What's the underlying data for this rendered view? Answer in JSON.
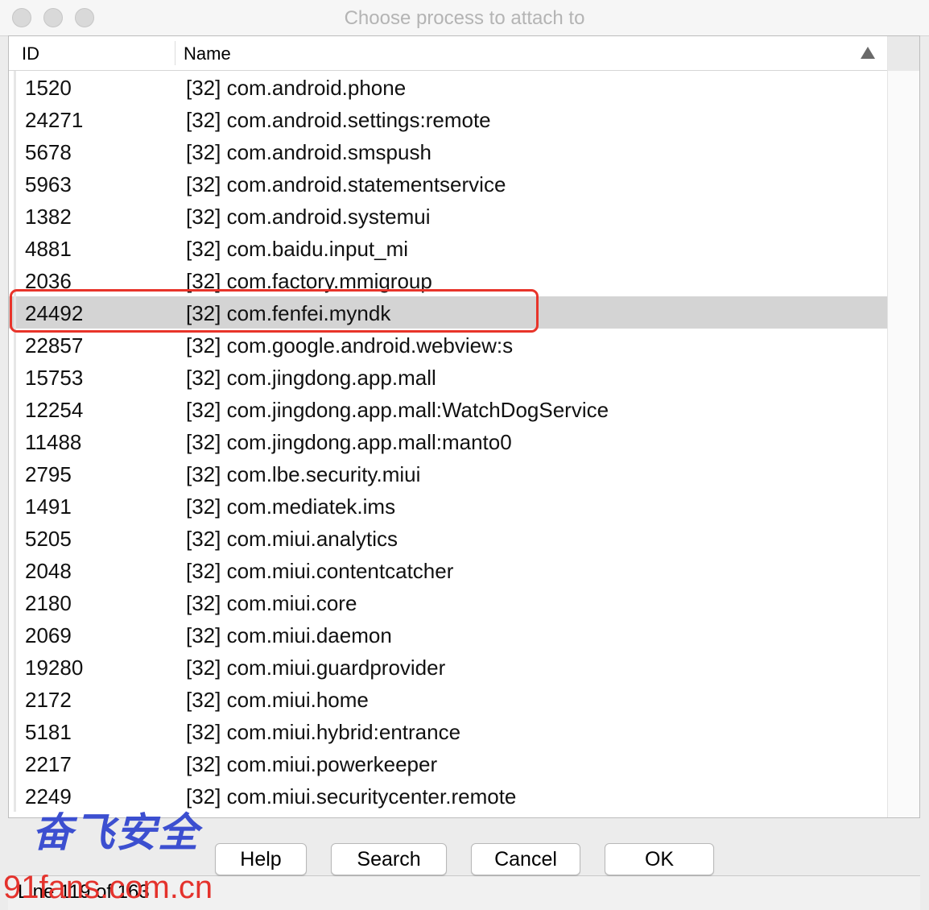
{
  "window": {
    "title": "Choose process to attach to"
  },
  "table": {
    "columns": {
      "id": "ID",
      "name": "Name"
    },
    "sort_indicator": "ascending",
    "selected_index": 7,
    "rows": [
      {
        "id": "1520",
        "name": "[32] com.android.phone"
      },
      {
        "id": "24271",
        "name": "[32] com.android.settings:remote"
      },
      {
        "id": "5678",
        "name": "[32] com.android.smspush"
      },
      {
        "id": "5963",
        "name": "[32] com.android.statementservice"
      },
      {
        "id": "1382",
        "name": "[32] com.android.systemui"
      },
      {
        "id": "4881",
        "name": "[32] com.baidu.input_mi"
      },
      {
        "id": "2036",
        "name": "[32] com.factory.mmigroup"
      },
      {
        "id": "24492",
        "name": "[32] com.fenfei.myndk"
      },
      {
        "id": "22857",
        "name": "[32] com.google.android.webview:s"
      },
      {
        "id": "15753",
        "name": "[32] com.jingdong.app.mall"
      },
      {
        "id": "12254",
        "name": "[32] com.jingdong.app.mall:WatchDogService"
      },
      {
        "id": "11488",
        "name": "[32] com.jingdong.app.mall:manto0"
      },
      {
        "id": "2795",
        "name": "[32] com.lbe.security.miui"
      },
      {
        "id": "1491",
        "name": "[32] com.mediatek.ims"
      },
      {
        "id": "5205",
        "name": "[32] com.miui.analytics"
      },
      {
        "id": "2048",
        "name": "[32] com.miui.contentcatcher"
      },
      {
        "id": "2180",
        "name": "[32] com.miui.core"
      },
      {
        "id": "2069",
        "name": "[32] com.miui.daemon"
      },
      {
        "id": "19280",
        "name": "[32] com.miui.guardprovider"
      },
      {
        "id": "2172",
        "name": "[32] com.miui.home"
      },
      {
        "id": "5181",
        "name": "[32] com.miui.hybrid:entrance"
      },
      {
        "id": "2217",
        "name": "[32] com.miui.powerkeeper"
      },
      {
        "id": "2249",
        "name": "[32] com.miui.securitycenter.remote"
      }
    ]
  },
  "buttons": {
    "help": "Help",
    "search": "Search",
    "cancel": "Cancel",
    "ok": "OK"
  },
  "status": {
    "text": "Line 119 of 163"
  },
  "watermark": {
    "brand": "奋飞安全",
    "url": "91fans.com.cn"
  },
  "colors": {
    "selection": "#d4d4d4",
    "highlight_box": "#e8342a",
    "watermark_brand": "#3c4fd0",
    "watermark_url": "#e4322c"
  }
}
